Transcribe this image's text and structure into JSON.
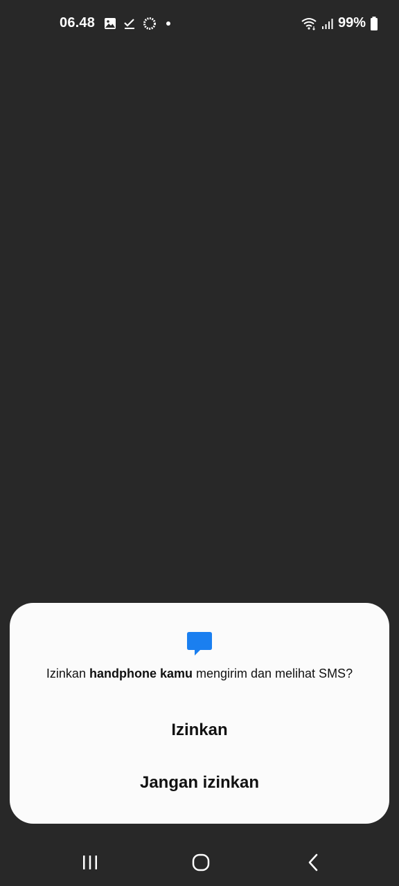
{
  "status_bar": {
    "time": "06.48",
    "battery_percent": "99%",
    "left_icons": [
      "gallery-icon",
      "checkmark-icon",
      "sync-icon",
      "dot-icon"
    ],
    "right_icons": [
      "wifi-icon",
      "signal-icon",
      "battery-icon"
    ]
  },
  "dialog": {
    "icon": "message-icon",
    "icon_color": "#1a7ff0",
    "message_prefix": "Izinkan ",
    "message_app": "handphone kamu",
    "message_suffix": " mengirim dan melihat SMS?",
    "allow_label": "Izinkan",
    "deny_label": "Jangan izinkan"
  },
  "nav_bar": {
    "buttons": [
      "recents-icon",
      "home-icon",
      "back-icon"
    ]
  },
  "colors": {
    "background": "#282828",
    "dialog_background": "#fbfbfb",
    "text": "#111111"
  }
}
